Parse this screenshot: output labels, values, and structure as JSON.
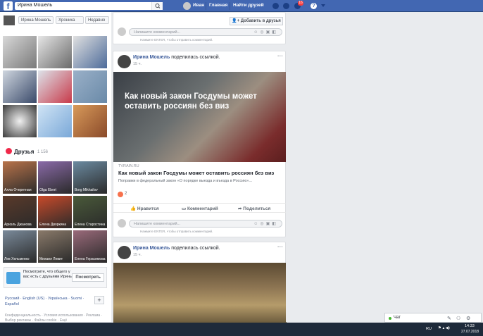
{
  "topbar": {
    "logo": "f",
    "search_value": "Ирина Мошель",
    "profile_name": "Иван",
    "nav_home": "Главная",
    "nav_find_friends": "Найти друзей",
    "notifications_count": "16",
    "help": "?"
  },
  "profile_tabs": {
    "name": "Ирина Мошель",
    "chronicle": "Хроника",
    "recent": "Недавно"
  },
  "friends": {
    "title": "Друзья",
    "count": "1 156",
    "list": [
      {
        "name": "Алла Очеретная",
        "color": "#b8734a"
      },
      {
        "name": "Olga Ebert",
        "color": "#8a6aa8"
      },
      {
        "name": "Borg Mikhailov",
        "color": "#6b8aa0"
      },
      {
        "name": "Ариэль Джанова",
        "color": "#5a3a2a"
      },
      {
        "name": "Елена Дворкина",
        "color": "#c84a2a"
      },
      {
        "name": "Елена Старостина",
        "color": "#4a5a3a"
      },
      {
        "name": "Лев Хельменко",
        "color": "#7a8a9a"
      },
      {
        "name": "Михаил Левит",
        "color": "#8a7a6a"
      },
      {
        "name": "Елена Герасимова",
        "color": "#9a6a7a"
      }
    ]
  },
  "suggest": {
    "text": "Посмотрите, что общего у вас есть с друзьями Ирины.",
    "button": "Посмотреть"
  },
  "languages": "Русский · English (US) · Українська · Suomi · Español",
  "footer": "Конфиденциальность · Условия использования · Реклама · Выбор рекламы · Файлы cookie · Ещё",
  "post_top": {
    "comment_placeholder": "Напишите комментарий...",
    "comment_hint": "Нажмите ENTER, чтобы отправить комментарий.",
    "add_friend": "Добавить в друзья"
  },
  "post1": {
    "author": "Ирина Мошель",
    "action": "поделилась ссылкой.",
    "time": "15 ч.",
    "image_headline": "Как новый закон Госдумы может оставить россиян без виз",
    "site": "TVRAIN.RU",
    "title": "Как новый закон Госдумы может оставить россиян без виз",
    "desc": "Поправки в федеральный закон «О порядке выезда и въезда в Россию»...",
    "reactions": "2",
    "like": "Нравится",
    "comment": "Комментарий",
    "share": "Поделиться",
    "comment_placeholder": "Напишите комментарий...",
    "comment_hint": "Нажмите ENTER, чтобы отправить комментарий."
  },
  "post2": {
    "author": "Ирина Мошель",
    "action": "поделилась ссылкой.",
    "time": "15 ч."
  },
  "chat": {
    "label": "Чат"
  },
  "taskbar": {
    "lang": "RU",
    "time": "14:33",
    "date": "27.07.2018"
  }
}
